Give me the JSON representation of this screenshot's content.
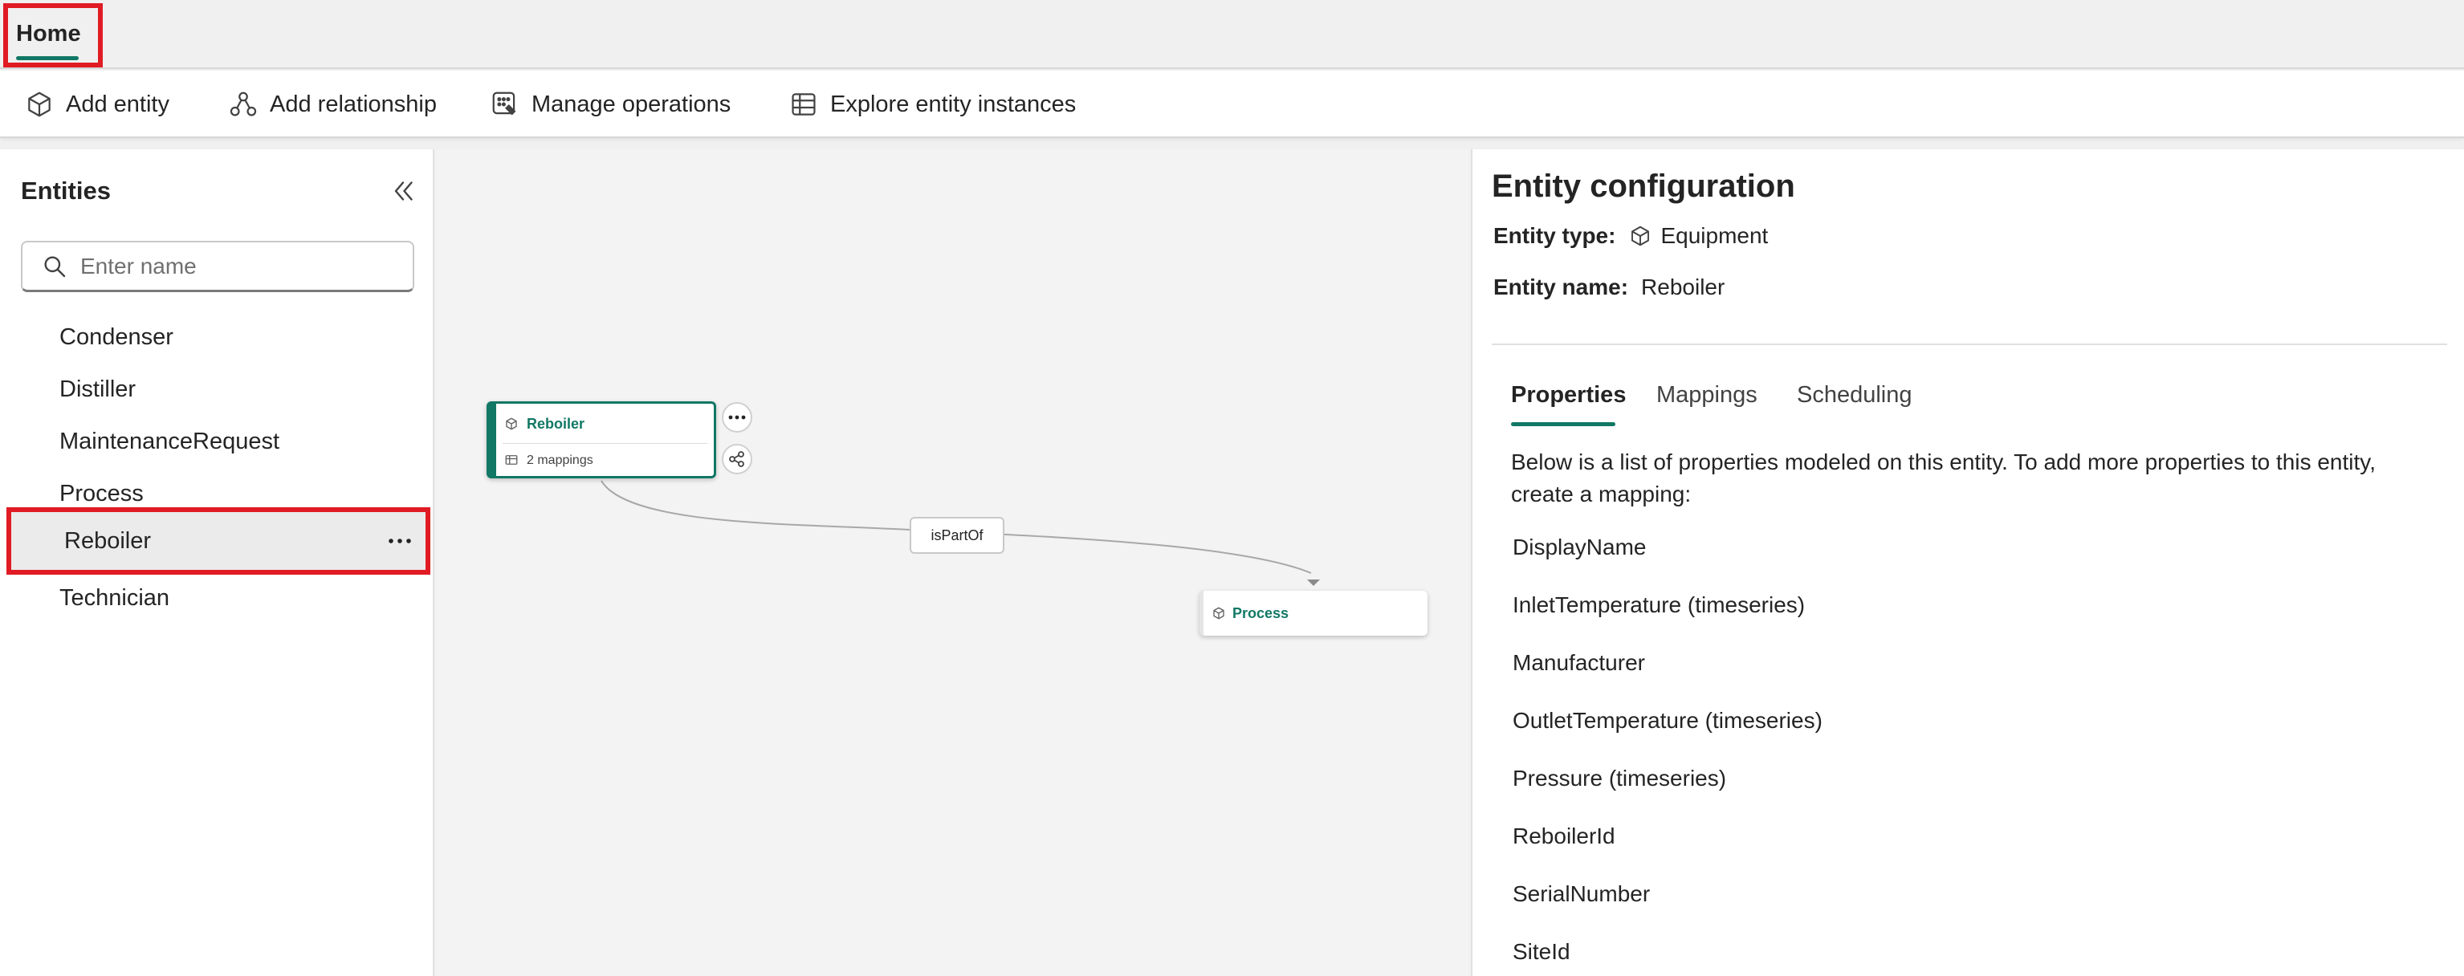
{
  "tabs": {
    "home": "Home"
  },
  "ribbon": {
    "add_entity": "Add entity",
    "add_relationship": "Add relationship",
    "manage_operations": "Manage operations",
    "explore_instances": "Explore entity instances"
  },
  "entities_panel": {
    "title": "Entities",
    "search_placeholder": "Enter name",
    "items": [
      "Condenser",
      "Distiller",
      "MaintenanceRequest",
      "Process",
      "Reboiler",
      "Technician"
    ],
    "selected": "Reboiler"
  },
  "canvas": {
    "node_main": {
      "name": "Reboiler",
      "mappings": "2 mappings"
    },
    "node_target": {
      "name": "Process"
    },
    "edge_label": "isPartOf"
  },
  "config": {
    "title": "Entity configuration",
    "type_label": "Entity type:",
    "type_value": "Equipment",
    "name_label": "Entity name:",
    "name_value": "Reboiler",
    "tabs": [
      "Properties",
      "Mappings",
      "Scheduling"
    ],
    "active_tab": "Properties",
    "description": "Below is a list of properties modeled on this entity. To add more properties to this entity, create a mapping:",
    "properties": [
      "DisplayName",
      "InletTemperature (timeseries)",
      "Manufacturer",
      "OutletTemperature (timeseries)",
      "Pressure (timeseries)",
      "ReboilerId",
      "SerialNumber",
      "SiteId"
    ]
  },
  "colors": {
    "accent": "#117865",
    "highlight": "#e01b24"
  }
}
